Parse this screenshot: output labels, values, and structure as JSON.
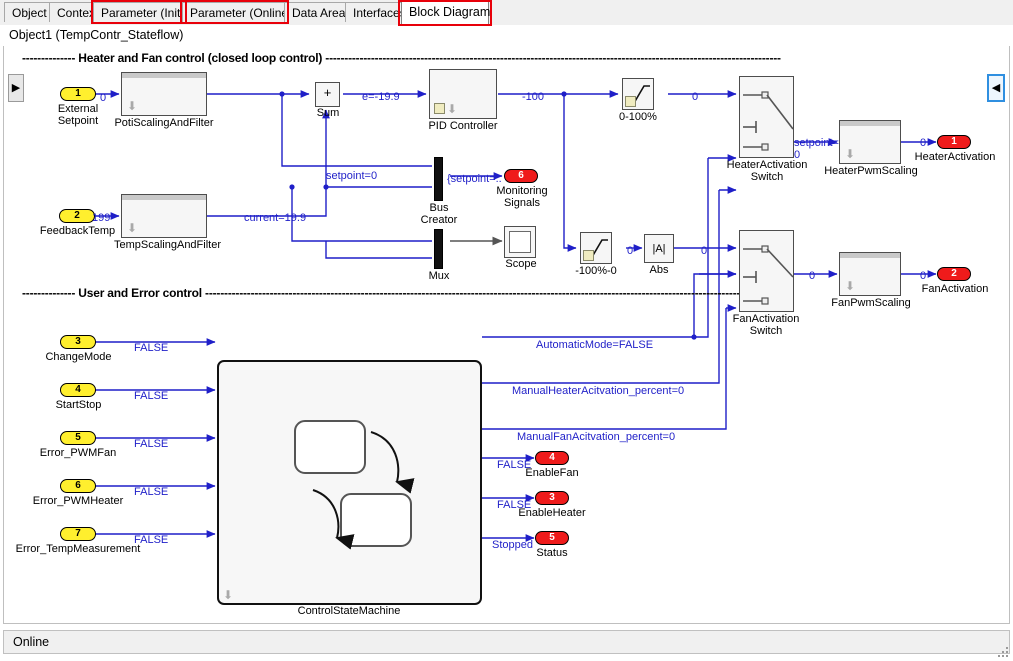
{
  "window": {
    "title": "Object1 (TempContr_Stateflow)",
    "status": "Online"
  },
  "tabs": [
    {
      "label": "Object",
      "active": false,
      "highlighted": false
    },
    {
      "label": "Context",
      "active": false,
      "highlighted": false
    },
    {
      "label": "Parameter (Init)",
      "active": false,
      "highlighted": true
    },
    {
      "label": "Parameter (Online)",
      "active": false,
      "highlighted": true
    },
    {
      "label": "Data Area",
      "active": false,
      "highlighted": false
    },
    {
      "label": "Interfaces",
      "active": false,
      "highlighted": false
    },
    {
      "label": "Block Diagram",
      "active": true,
      "highlighted": true
    }
  ],
  "colors": {
    "signal": "#1f1fc8",
    "highlight": "#e8000a",
    "inport": "#ffef2e",
    "outport": "#ef1b1b",
    "block_fill": "#f6f6f6",
    "block_border": "#4d4d4d",
    "mux": "#111111"
  },
  "navigation": {
    "left_expand_icon": "triangle-right-icon",
    "right_collapse_icon": "triangle-left-icon"
  },
  "annotations": [
    {
      "id": "ann_top",
      "text": "-------------- Heater and Fan control (closed loop control) ------------------------------------------------------------------------------------------------------------------------"
    },
    {
      "id": "ann_bottom",
      "text": "-------------- User and Error control ----------------------------------------------------------------------------------------------------------------------------------------------------"
    }
  ],
  "inports": [
    {
      "num": "1",
      "label": "External\nSetpoint",
      "name": "ExternalSetpoint"
    },
    {
      "num": "2",
      "label": "FeedbackTemp",
      "name": "FeedbackTemp"
    },
    {
      "num": "3",
      "label": "ChangeMode",
      "name": "ChangeMode"
    },
    {
      "num": "4",
      "label": "StartStop",
      "name": "StartStop"
    },
    {
      "num": "5",
      "label": "Error_PWMFan",
      "name": "Error_PWMFan"
    },
    {
      "num": "6",
      "label": "Error_PWMHeater",
      "name": "Error_PWMHeater"
    },
    {
      "num": "7",
      "label": "Error_TempMeasurement",
      "name": "Error_TempMeasurement"
    }
  ],
  "outports": [
    {
      "num": "1",
      "label": "HeaterActivation",
      "name": "HeaterActivation"
    },
    {
      "num": "2",
      "label": "FanActivation",
      "name": "FanActivation"
    },
    {
      "num": "3",
      "label": "EnableHeater",
      "name": "EnableHeater"
    },
    {
      "num": "4",
      "label": "EnableFan",
      "name": "EnableFan"
    },
    {
      "num": "5",
      "label": "Status",
      "name": "Status"
    },
    {
      "num": "6",
      "label": "Monitoring\nSignals",
      "name": "MonitoringSignals"
    }
  ],
  "blocks": {
    "poti_scaling": {
      "label": "PotiScalingAndFilter"
    },
    "temp_scaling": {
      "label": "TempScalingAndFilter"
    },
    "sum": {
      "label": "Sum",
      "glyph": "+"
    },
    "pid": {
      "label": "PID Controller"
    },
    "sat_heater": {
      "label": "0-100%"
    },
    "sat_fan": {
      "label": "-100%-0"
    },
    "abs": {
      "label": "Abs",
      "glyph": "|A|"
    },
    "bus_creator": {
      "label": "Bus\nCreator"
    },
    "mux": {
      "label": "Mux"
    },
    "scope": {
      "label": "Scope"
    },
    "heater_switch": {
      "label": "HeaterActivation\nSwitch"
    },
    "fan_switch": {
      "label": "FanActivation\nSwitch"
    },
    "heater_pwm": {
      "label": "HeaterPwmScaling"
    },
    "fan_pwm": {
      "label": "FanPwmScaling"
    },
    "state_machine": {
      "label": "ControlStateMachine"
    }
  },
  "signal_labels": {
    "setpoint_in": "0",
    "feedback_in": "199",
    "error": "e=-19.9",
    "current": "current=19.9",
    "setpoint_tap": "setpoint=0",
    "pid_out": "-100",
    "sat_heater_out": "0",
    "sat_fan_out": "0",
    "abs_out": "0",
    "bus_out": "{setpoint=..",
    "heater_switch_out": "setpoint=\n0",
    "heater_pwm_out": "0",
    "fan_switch_out": "0",
    "fan_pwm_out": "0",
    "change_mode": "FALSE",
    "start_stop": "FALSE",
    "error_pwmfan": "FALSE",
    "error_pwmheater": "FALSE",
    "error_tempmeas": "FALSE",
    "automatic_mode": "AutomaticMode=FALSE",
    "manual_heater": "ManualHeaterAcitvation_percent=0",
    "manual_fan": "ManualFanAcitvation_percent=0",
    "enable_fan": "FALSE",
    "enable_heater": "FALSE",
    "status": "Stopped"
  }
}
